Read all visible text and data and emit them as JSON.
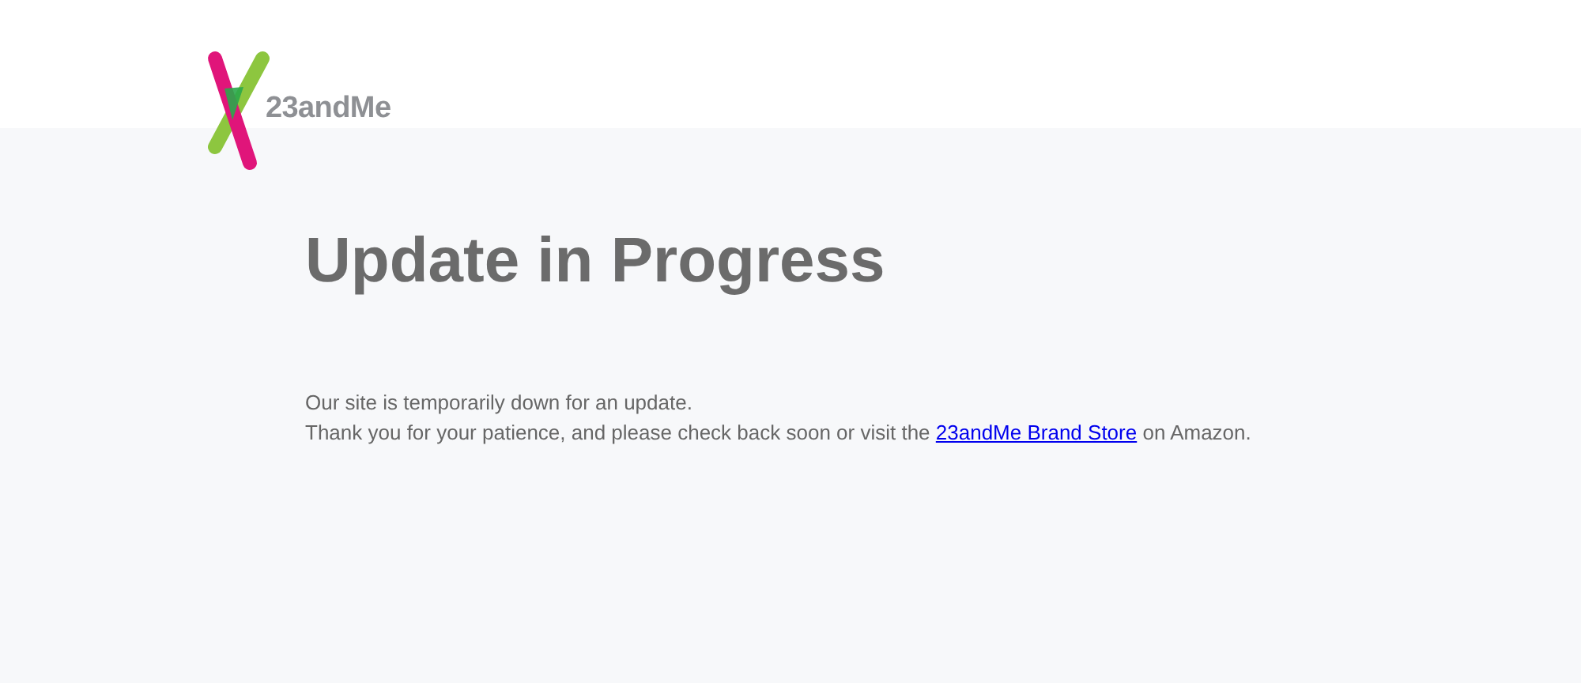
{
  "header": {
    "logo_text": "23andMe"
  },
  "heading": "Update in Progress",
  "message": {
    "line_1": "Our site is temporarily down for an update.",
    "line_2_before": "Thank you for your patience, and please check back soon or visit the ",
    "link": "23andMe Brand Store",
    "line_2_after": " on Amazon."
  }
}
